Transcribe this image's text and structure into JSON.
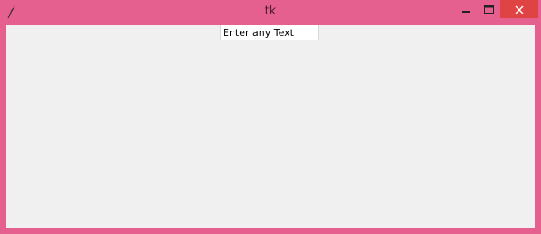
{
  "window": {
    "title": "tk",
    "frame_color": "#e6608f",
    "close_color": "#e04343",
    "client_color": "#f0f0f0"
  },
  "icons": {
    "app": "feather-icon",
    "minimize": "minimize-icon",
    "maximize": "maximize-icon",
    "close": "close-icon"
  },
  "entry": {
    "value": "Enter any Text"
  }
}
